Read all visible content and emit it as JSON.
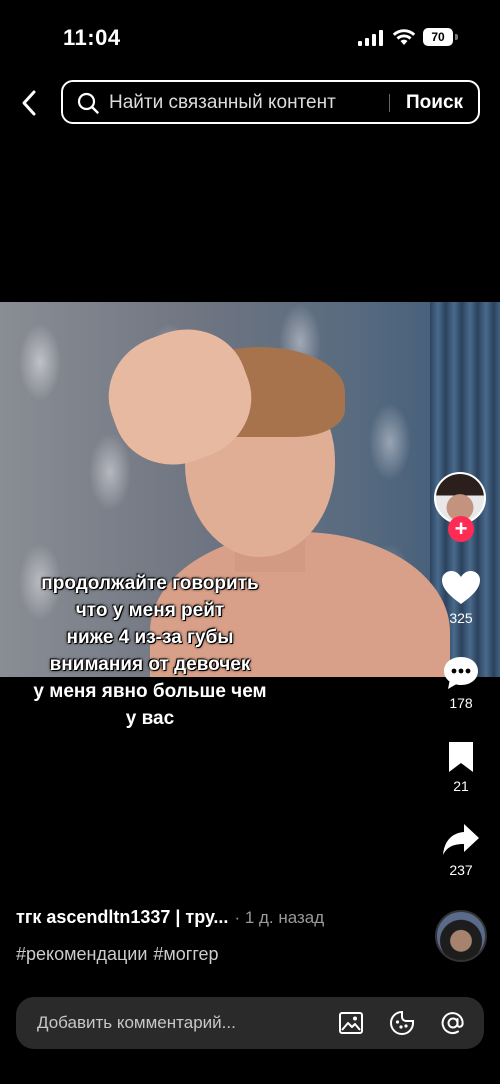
{
  "status": {
    "time": "11:04",
    "battery": "70"
  },
  "search": {
    "placeholder": "Найти связанный контент",
    "button": "Поиск"
  },
  "video": {
    "caption": [
      "продолжайте говорить",
      "что у меня рейт",
      "ниже 4 из-за губы",
      "внимания от девочек",
      "у меня явно больше чем",
      "у вас"
    ]
  },
  "actions": {
    "likes": "325",
    "comments": "178",
    "saves": "21",
    "shares": "237"
  },
  "post": {
    "author": "тгк ascendltn1337 | тру...",
    "time_ago": "· 1 д. назад",
    "hashtags": [
      "#рекомендации",
      "#моггер"
    ]
  },
  "comment_bar": {
    "placeholder": "Добавить комментарий..."
  },
  "colors": {
    "accent": "#fe2c55",
    "background": "#000000"
  }
}
